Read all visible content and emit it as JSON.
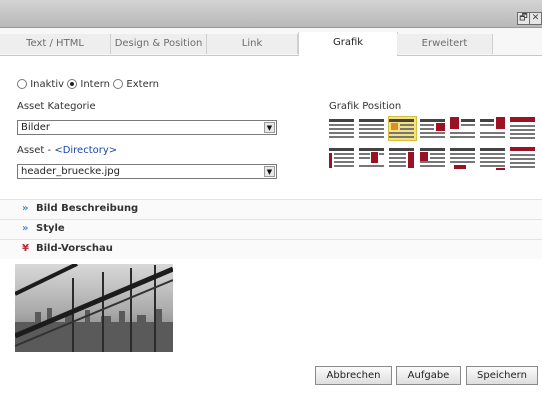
{
  "window": {
    "restore_glyph": "🗗",
    "close_glyph": "✕"
  },
  "tabs": [
    {
      "label": "Text / HTML"
    },
    {
      "label": "Design & Position"
    },
    {
      "label": "Link"
    },
    {
      "label": "Grafik"
    },
    {
      "label": "Erweitert"
    }
  ],
  "mode": {
    "options": [
      "Inaktiv",
      "Intern",
      "Extern"
    ],
    "selected": "Intern"
  },
  "asset_kategorie": {
    "label": "Asset Kategorie",
    "value": "Bilder"
  },
  "asset": {
    "label_prefix": "Asset - ",
    "link_text": "<Directory>",
    "value": "header_bruecke.jpg"
  },
  "grafik_position": {
    "label": "Grafik Position",
    "selected_index": 2
  },
  "sections": [
    {
      "title": "Bild Beschreibung",
      "icon": "expand-icon",
      "glyph": "»"
    },
    {
      "title": "Style",
      "icon": "expand-icon",
      "glyph": "»"
    },
    {
      "title": "Bild-Vorschau",
      "icon": "collapse-icon",
      "glyph": "¥"
    }
  ],
  "buttons": {
    "cancel": "Abbrechen",
    "task": "Aufgabe",
    "save": "Speichern"
  }
}
